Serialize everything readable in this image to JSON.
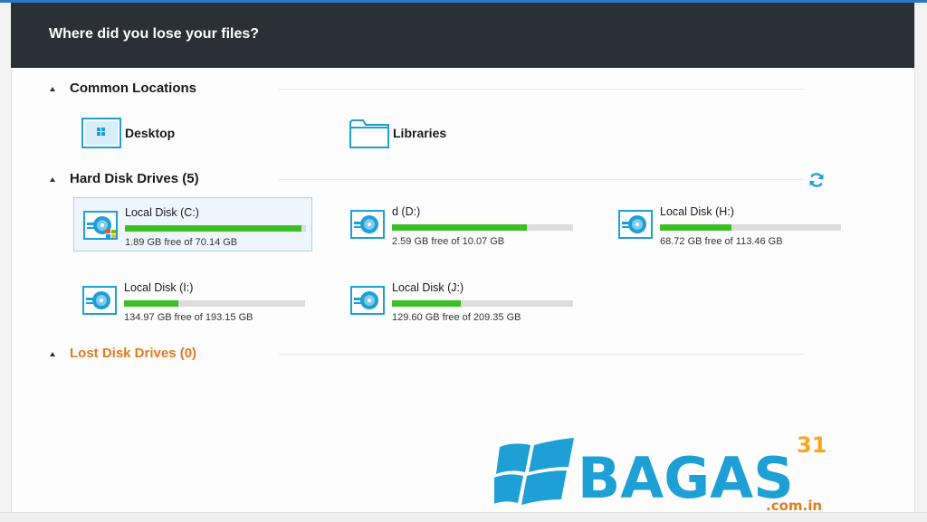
{
  "header": {
    "title": "Where did you lose your files?"
  },
  "sections": {
    "common": {
      "title": "Common Locations"
    },
    "hard_disks": {
      "title": "Hard Disk Drives (5)"
    },
    "lost": {
      "title": "Lost Disk Drives (0)"
    }
  },
  "locations": [
    {
      "label": "Desktop",
      "icon": "desktop-icon"
    },
    {
      "label": "Libraries",
      "icon": "folder-icon"
    }
  ],
  "drives": [
    {
      "name": "Local Disk (C:)",
      "free": "1.89 GB free of 70.14 GB",
      "used_fraction": 0.973,
      "selected": true,
      "system": true
    },
    {
      "name": "d (D:)",
      "free": "2.59 GB free of 10.07 GB",
      "used_fraction": 0.743
    },
    {
      "name": "Local Disk (H:)",
      "free": "68.72 GB free of 113.46 GB",
      "used_fraction": 0.394
    },
    {
      "name": "Local Disk (I:)",
      "free": "134.97 GB free of 193.15 GB",
      "used_fraction": 0.301
    },
    {
      "name": "Local Disk (J:)",
      "free": "129.60 GB free of 209.35 GB",
      "used_fraction": 0.381
    }
  ],
  "watermark": {
    "brand": "BAGAS",
    "number": "31",
    "domain": ".com.in"
  },
  "colors": {
    "header_bg": "#2b2f36",
    "accent": "#2b78c2",
    "progress": "#3cbf23",
    "lost_orange": "#e07b1f",
    "icon_blue": "#1e9fd6"
  }
}
